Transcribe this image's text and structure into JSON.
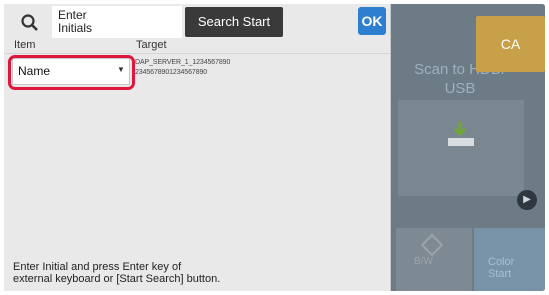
{
  "search_bar": {
    "initials_label": "Enter\nInitials",
    "search_button": "Search Start",
    "ok_button": "OK"
  },
  "columns": {
    "item": "Item",
    "target": "Target"
  },
  "row": {
    "item_select": "Name",
    "target_value": "DAP_SERVER_1_1234567890\n2345678901234567890"
  },
  "footer_text": "Enter Initial and press Enter key of\nexternal keyboard or [Start Search] button.",
  "background": {
    "title": "Scan to HDD/\nUSB",
    "ca_button": "CA",
    "bw_label": "B/W",
    "color_label": "Color\nStart"
  },
  "colors": {
    "ok_blue": "#2f7fd1",
    "highlight_red": "#e0173d",
    "ca_gold": "#c8a04a"
  }
}
